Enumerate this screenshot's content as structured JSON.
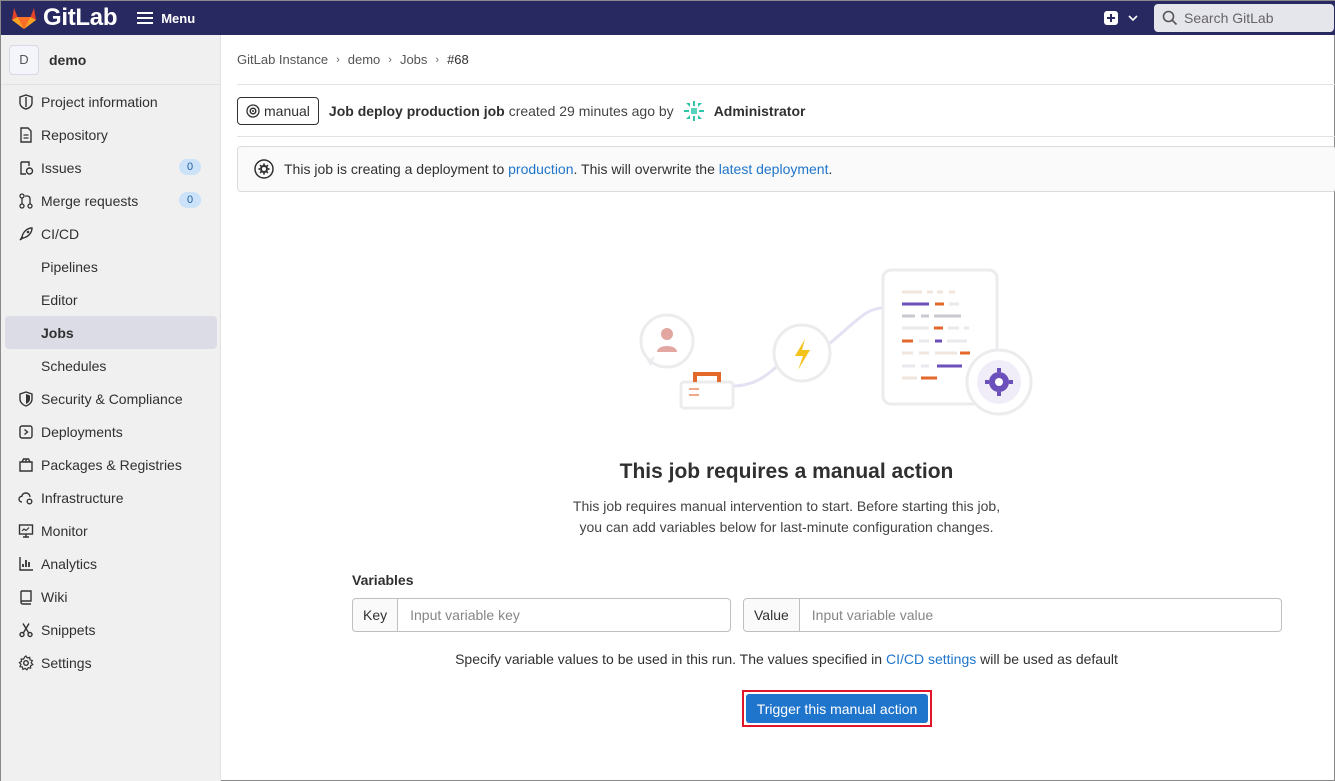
{
  "topbar": {
    "brand_name": "GitLab",
    "menu_label": "Menu",
    "search_placeholder": "Search GitLab"
  },
  "sidebar": {
    "project_initial": "D",
    "project_name": "demo",
    "items": [
      {
        "label": "Project information",
        "icon": "info-doc-icon"
      },
      {
        "label": "Repository",
        "icon": "doc-icon"
      },
      {
        "label": "Issues",
        "icon": "issues-icon",
        "badge": "0"
      },
      {
        "label": "Merge requests",
        "icon": "merge-request-icon",
        "badge": "0"
      },
      {
        "label": "CI/CD",
        "icon": "rocket-icon"
      },
      {
        "label": "Pipelines",
        "sub": true
      },
      {
        "label": "Editor",
        "sub": true
      },
      {
        "label": "Jobs",
        "sub": true,
        "active": true
      },
      {
        "label": "Schedules",
        "sub": true
      },
      {
        "label": "Security & Compliance",
        "icon": "shield-icon"
      },
      {
        "label": "Deployments",
        "icon": "deployments-icon"
      },
      {
        "label": "Packages & Registries",
        "icon": "package-icon"
      },
      {
        "label": "Infrastructure",
        "icon": "cloud-gear-icon"
      },
      {
        "label": "Monitor",
        "icon": "monitor-icon"
      },
      {
        "label": "Analytics",
        "icon": "chart-icon"
      },
      {
        "label": "Wiki",
        "icon": "book-icon"
      },
      {
        "label": "Snippets",
        "icon": "scissors-icon"
      },
      {
        "label": "Settings",
        "icon": "gear-icon"
      }
    ]
  },
  "breadcrumb": [
    "GitLab Instance",
    "demo",
    "Jobs",
    "#68"
  ],
  "job": {
    "status": "manual",
    "title": "Job deploy production job",
    "meta": "created 29 minutes ago by",
    "author": "Administrator"
  },
  "alert": {
    "prefix": "This job is creating a deployment to",
    "env_link": "production",
    "middle": ". This will overwrite the",
    "latest_link": "latest deployment",
    "suffix": "."
  },
  "empty_state": {
    "title": "This job requires a manual action",
    "desc_line1": "This job requires manual intervention to start. Before starting this job,",
    "desc_line2": "you can add variables below for last-minute configuration changes."
  },
  "variables": {
    "label": "Variables",
    "key_addon": "Key",
    "key_placeholder": "Input variable key",
    "value_addon": "Value",
    "value_placeholder": "Input variable value",
    "hint_prefix": "Specify variable values to be used in this run. The values specified in",
    "hint_link": "CI/CD settings",
    "hint_suffix": "will be used as default"
  },
  "trigger_button": "Trigger this manual action",
  "colors": {
    "topbar": "#292961",
    "primary": "#1f75cb",
    "highlight_border": "#e0152a"
  }
}
